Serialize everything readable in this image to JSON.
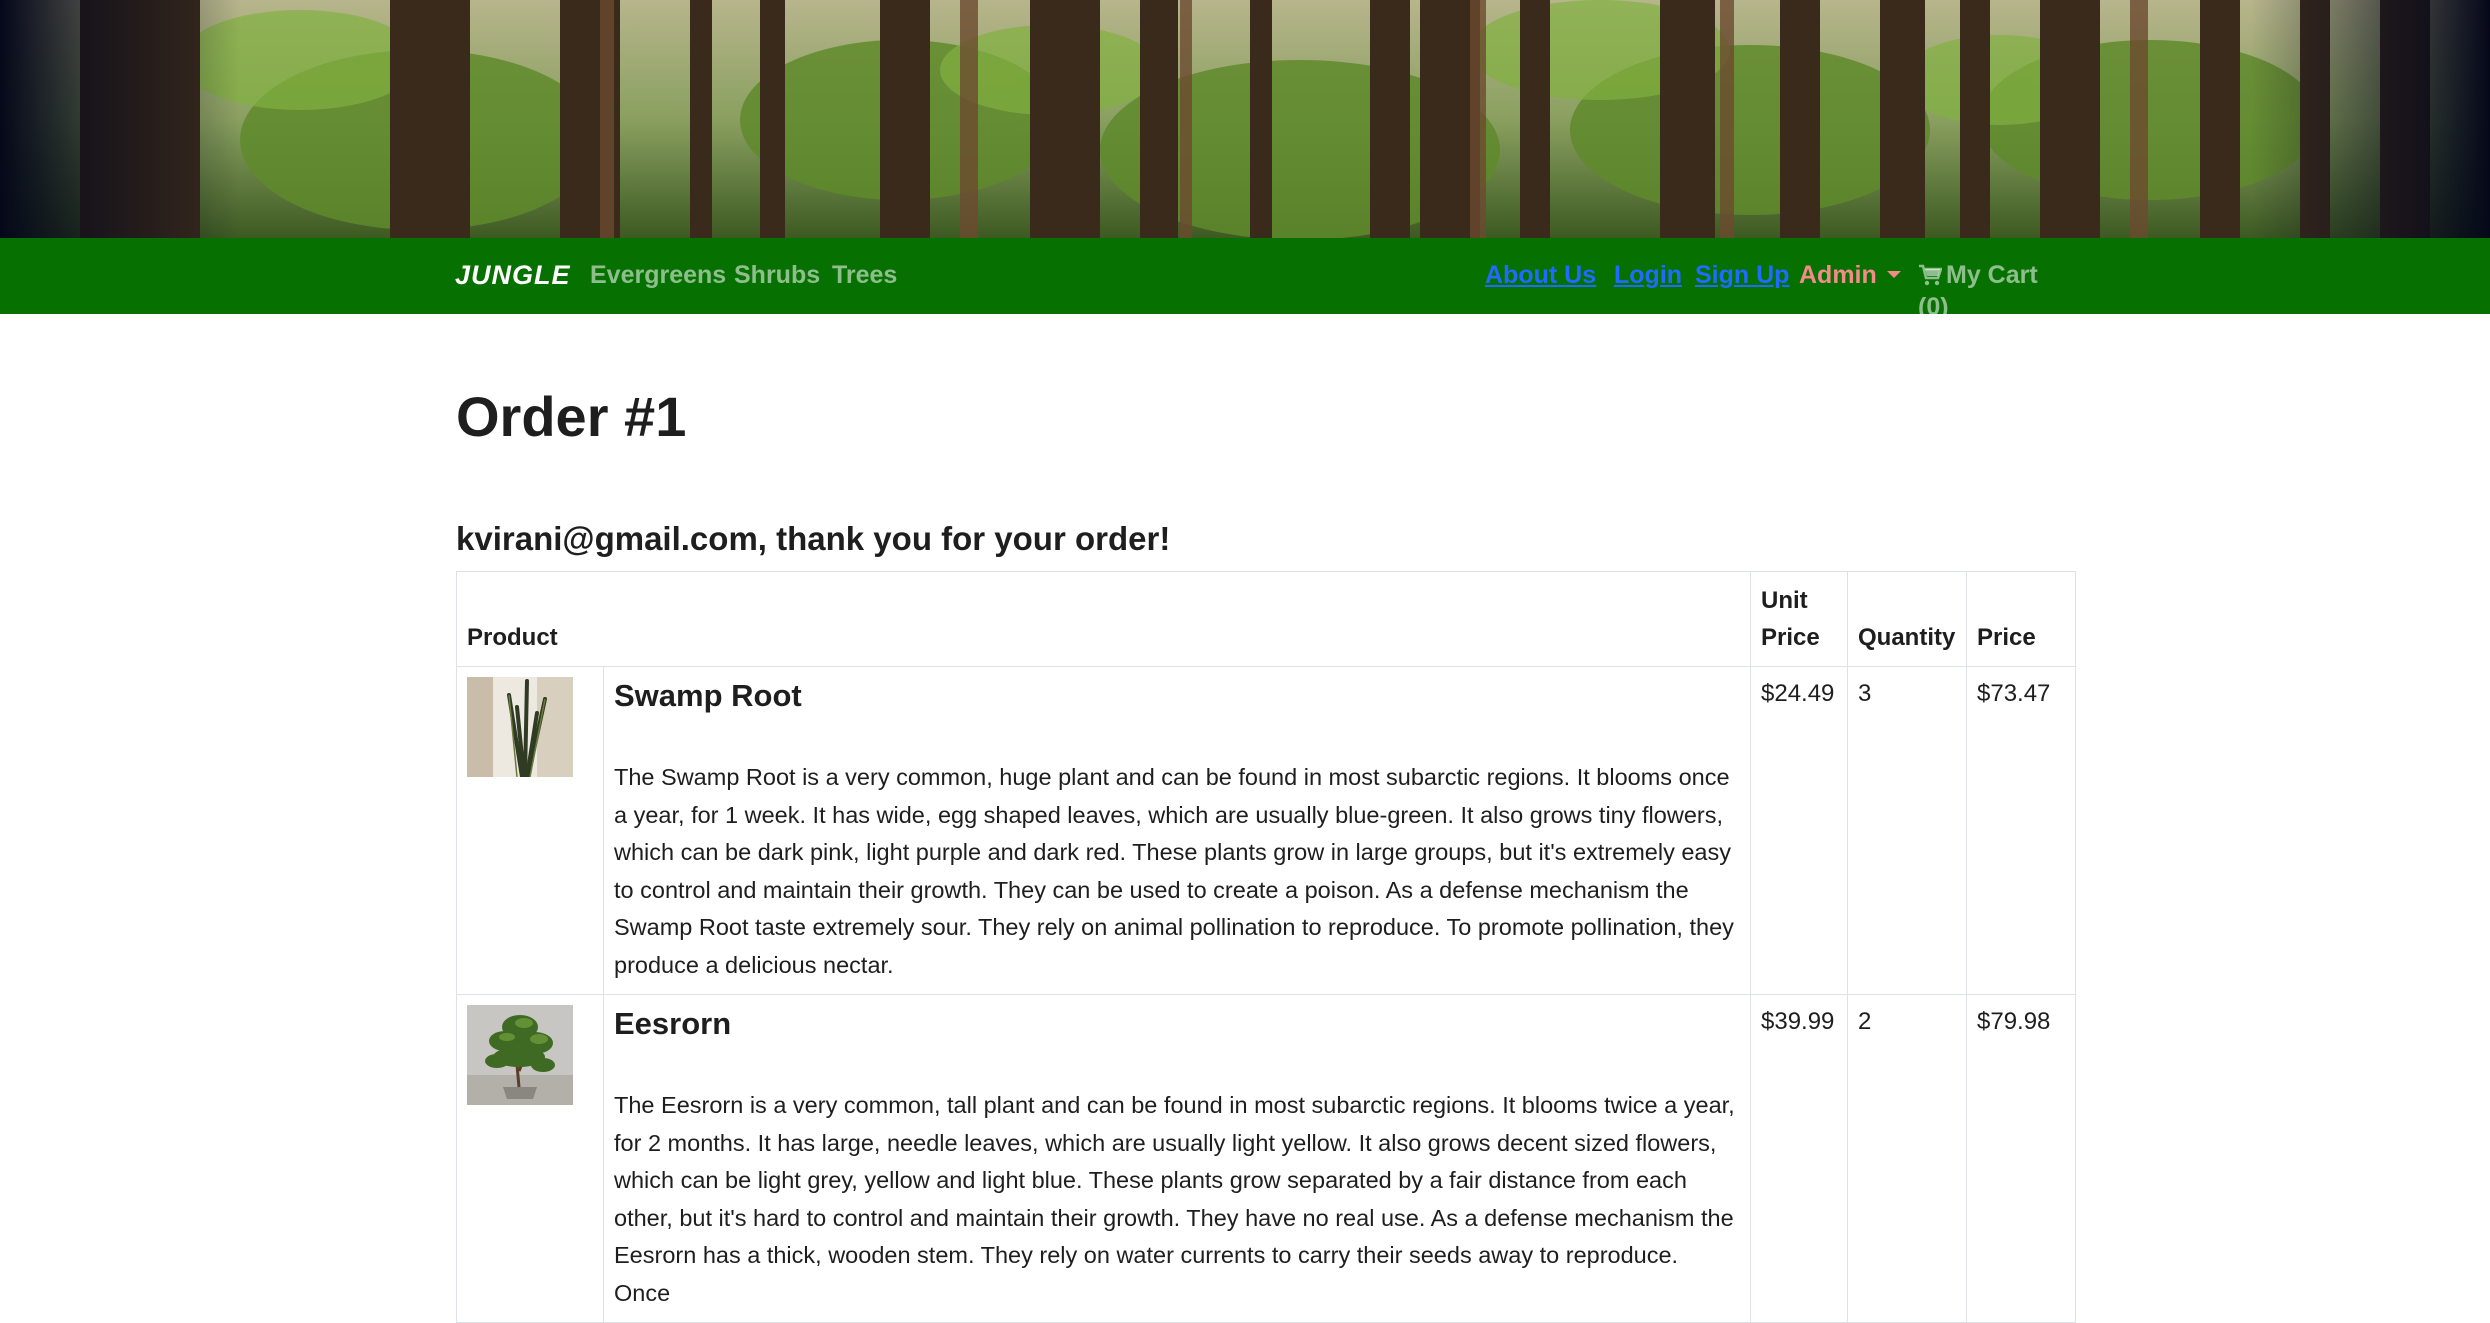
{
  "nav": {
    "brand": "JUNGLE",
    "left_links": [
      "Evergreens",
      "Shrubs",
      "Trees"
    ],
    "about": "About Us",
    "login": "Login",
    "signup": "Sign Up",
    "admin": "Admin",
    "cart": "My Cart (0)"
  },
  "page": {
    "title": "Order #1",
    "thanks": "kvirani@gmail.com, thank you for your order!"
  },
  "table": {
    "headers": {
      "product": "Product",
      "unit_price": "Unit Price",
      "quantity": "Quantity",
      "price": "Price"
    },
    "rows": [
      {
        "name": "Swamp Root",
        "description": "The Swamp Root is a very common, huge plant and can be found in most subarctic regions. It blooms once a year, for 1 week. It has wide, egg shaped leaves, which are usually blue-green. It also grows tiny flowers, which can be dark pink, light purple and dark red. These plants grow in large groups, but it's extremely easy to control and maintain their growth. They can be used to create a poison. As a defense mechanism the Swamp Root taste extremely sour. They rely on animal pollination to reproduce. To promote pollination, they produce a delicious nectar.",
        "unit_price": "$24.49",
        "quantity": "3",
        "price": "$73.47"
      },
      {
        "name": "Eesrorn",
        "description": "The Eesrorn is a very common, tall plant and can be found in most subarctic regions. It blooms twice a year, for 2 months. It has large, needle leaves, which are usually light yellow. It also grows decent sized flowers, which can be light grey, yellow and light blue. These plants grow separated by a fair distance from each other, but it's hard to control and maintain their growth. They have no real use. As a defense mechanism the Eesrorn has a thick, wooden stem. They rely on water currents to carry their seeds away to reproduce. Once",
        "unit_price": "$39.99",
        "quantity": "2",
        "price": "$79.98"
      }
    ]
  },
  "colors": {
    "navbar": "#067000",
    "link_blue": "#1f6bff",
    "admin_pink": "#f58a8a"
  },
  "icons": [
    "cart-icon"
  ]
}
